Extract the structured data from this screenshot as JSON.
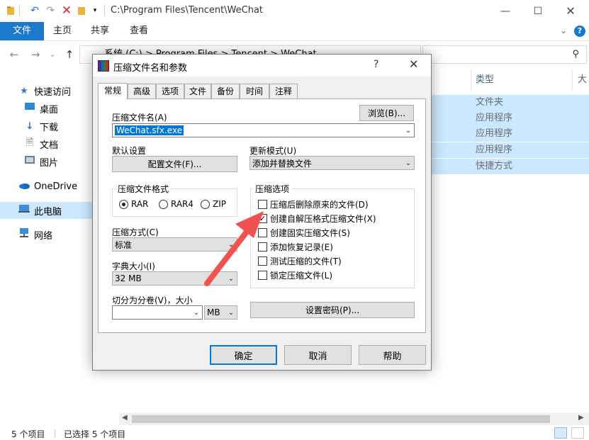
{
  "window": {
    "title_path": "C:\\Program Files\\Tencent\\WeChat",
    "quick_access": [
      "folder-icon",
      "undo-icon",
      "redo-icon",
      "delete-icon",
      "folder-icon",
      "dropdown-icon"
    ]
  },
  "ribbon": {
    "tabs": [
      "文件",
      "主页",
      "共享",
      "查看"
    ]
  },
  "address": {
    "text": "系统 (C:)  >  Program Files  >  Tencent  >  WeChat"
  },
  "sidebar": {
    "items": [
      {
        "label": "快速访问",
        "icon": "star-icon"
      },
      {
        "label": "桌面",
        "icon": "desktop-icon"
      },
      {
        "label": "下载",
        "icon": "download-icon"
      },
      {
        "label": "文档",
        "icon": "document-icon"
      },
      {
        "label": "图片",
        "icon": "pictures-icon"
      },
      {
        "label": "OneDrive",
        "icon": "cloud-icon"
      },
      {
        "label": "此电脑",
        "icon": "computer-icon"
      },
      {
        "label": "网络",
        "icon": "network-icon"
      }
    ]
  },
  "files": {
    "column_type": "类型",
    "column_size": "大小",
    "types": [
      "文件夹",
      "应用程序",
      "应用程序",
      "应用程序",
      "快捷方式"
    ]
  },
  "status": {
    "count": "5 个项目",
    "selected": "已选择 5 个项目"
  },
  "dialog": {
    "title": "压缩文件名和参数",
    "help_glyph": "?",
    "tabs": [
      "常规",
      "高级",
      "选项",
      "文件",
      "备份",
      "时间",
      "注释"
    ],
    "archive_name_label": "压缩文件名(A)",
    "browse_button": "浏览(B)...",
    "archive_name_value": "WeChat.sfx.exe",
    "default_settings_label": "默认设置",
    "profiles_button": "配置文件(F)...",
    "update_mode_label": "更新模式(U)",
    "update_mode_value": "添加并替换文件",
    "format_group": "压缩文件格式",
    "formats": [
      {
        "label": "RAR",
        "checked": true
      },
      {
        "label": "RAR4",
        "checked": false
      },
      {
        "label": "ZIP",
        "checked": false
      }
    ],
    "method_label": "压缩方式(C)",
    "method_value": "标准",
    "dict_label": "字典大小(I)",
    "dict_value": "32 MB",
    "split_label": "切分为分卷(V)，大小",
    "split_value": "",
    "split_unit": "MB",
    "options_group": "压缩选项",
    "options": [
      {
        "label": "压缩后删除原来的文件(D)",
        "checked": false
      },
      {
        "label": "创建自解压格式压缩文件(X)",
        "checked": true
      },
      {
        "label": "创建固实压缩文件(S)",
        "checked": false
      },
      {
        "label": "添加恢复记录(E)",
        "checked": false
      },
      {
        "label": "测试压缩的文件(T)",
        "checked": false
      },
      {
        "label": "锁定压缩文件(L)",
        "checked": false
      }
    ],
    "password_button": "设置密码(P)...",
    "ok_button": "确定",
    "cancel_button": "取消",
    "help_button": "帮助"
  },
  "colors": {
    "accent": "#1979ca",
    "selection": "#cce8ff",
    "annotation_arrow": "#f0524f"
  }
}
